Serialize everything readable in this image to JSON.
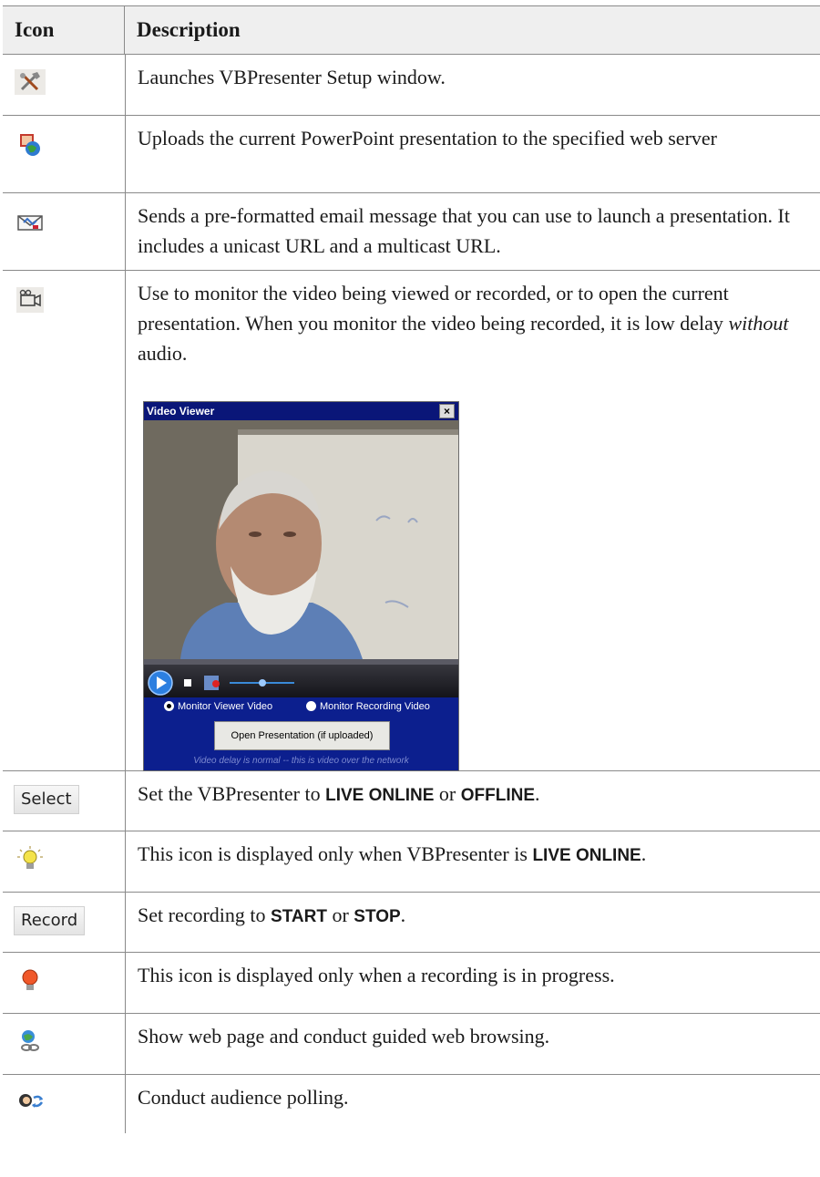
{
  "header": {
    "icon": "Icon",
    "description": "Description"
  },
  "rows": [
    {
      "icon": "tools-icon",
      "text": "Launches VBPresenter Setup window."
    },
    {
      "icon": "upload-globe-icon",
      "text": "Uploads the current PowerPoint presentation to the specified web server"
    },
    {
      "icon": "email-envelope-icon",
      "text": "Sends a pre-formatted email message that you can use to launch a presentation. It includes a unicast URL and a multicast URL."
    },
    {
      "icon": "video-camera-icon",
      "text_before": "Use to monitor the video being viewed or recorded, or to open the current presentation. When you monitor the video being recorded, it is low delay ",
      "text_em": "without",
      "text_after": " audio."
    },
    {
      "icon_label": "Select",
      "text_before": "Set the VBPresenter to ",
      "kw1": "LIVE ONLINE",
      "text_mid": " or ",
      "kw2": "OFFLINE",
      "text_after": "."
    },
    {
      "icon": "yellow-lightbulb-icon",
      "text_before": "This icon is displayed only when VBPresenter is ",
      "kw1": "LIVE ONLINE",
      "text_after": "."
    },
    {
      "icon_label": "Record",
      "text_before": "Set recording to ",
      "kw1": "START",
      "text_mid": " or ",
      "kw2": "STOP",
      "text_after": "."
    },
    {
      "icon": "red-lightbulb-icon",
      "text": "This icon is displayed only when a recording is in progress."
    },
    {
      "icon": "web-link-icon",
      "text": "Show web page and conduct guided web browsing."
    },
    {
      "icon": "audience-poll-icon",
      "text": "Conduct audience polling."
    }
  ],
  "video_viewer": {
    "title": "Video Viewer",
    "close": "×",
    "radio1": "Monitor Viewer Video",
    "radio2": "Monitor Recording Video",
    "open_button": "Open Presentation (if uploaded)",
    "footer": "Video delay is normal -- this is video over the network"
  }
}
